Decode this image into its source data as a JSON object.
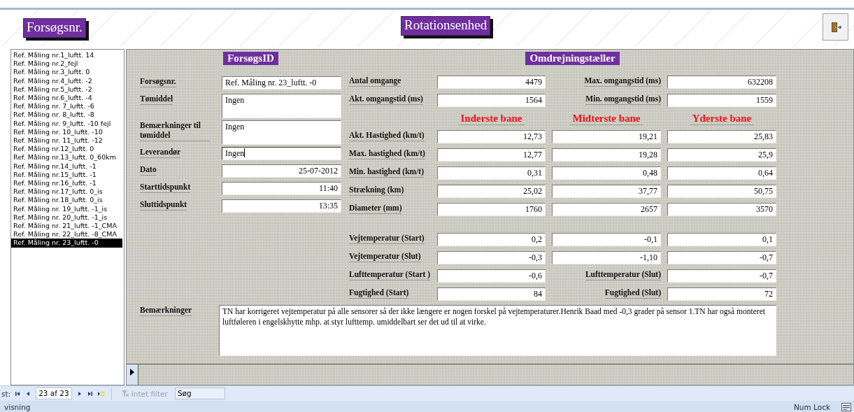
{
  "header": {
    "record_button": "Forsøgsnr.",
    "title": "Rotationsenhed"
  },
  "record_list": [
    {
      "label": "Ref. Måling nr.1_luftt. 14",
      "selected": false
    },
    {
      "label": "Ref. Måling nr.2_fejl",
      "selected": false
    },
    {
      "label": "Ref. Måling nr.3_luftt. 0",
      "selected": false
    },
    {
      "label": "Ref. Måling nr.4_luftt. -2",
      "selected": false
    },
    {
      "label": "Ref. Måling nr.5_luftt. -2",
      "selected": false
    },
    {
      "label": "Ref. Måling nr.6_luftt. -4",
      "selected": false
    },
    {
      "label": "Ref. Måling nr. 7_luftt. -6",
      "selected": false
    },
    {
      "label": "Ref. Måling nr. 8_luftt. -8",
      "selected": false
    },
    {
      "label": "Ref. Måling nr. 9_luftt. -10 fejl",
      "selected": false
    },
    {
      "label": "Ref. Måling nr.  10_luftt. -10",
      "selected": false
    },
    {
      "label": "Ref. Måling nr.  11_luftt. -12",
      "selected": false
    },
    {
      "label": "Ref. Måling nr.12_luftt. 0",
      "selected": false
    },
    {
      "label": "Ref. Måling nr.13_luftt. 0_60km",
      "selected": false
    },
    {
      "label": "Ref. Måling nr.14_luftt. -1",
      "selected": false
    },
    {
      "label": "Ref. Måling nr.15_luftt. -1",
      "selected": false
    },
    {
      "label": "Ref. Måling nr.16_luftt. -1",
      "selected": false
    },
    {
      "label": "Ref. Måling nr.17_luftt. 0_is",
      "selected": false
    },
    {
      "label": "Ref. Måling nr.18_luftt. 0_is",
      "selected": false
    },
    {
      "label": "Ref. Måling nr. 19_luftt. -1_is",
      "selected": false
    },
    {
      "label": "Ref. Måling nr. 20_luftt. -1_is",
      "selected": false
    },
    {
      "label": "Ref. Måling nr. 21_luftt. -1_CMA",
      "selected": false
    },
    {
      "label": "Ref. Måling nr. 22_luftt. -8_CMA",
      "selected": false
    },
    {
      "label": "Ref. Måling nr. 23_luftt. -0",
      "selected": true
    }
  ],
  "section_titles": [
    "ForsøgsID",
    "Omdrejningstæller"
  ],
  "id_fields": [
    {
      "label": "Forsøgsnr.",
      "value": "Ref. Måling nr. 23_luftt. -0",
      "kind": "text",
      "focused": false
    },
    {
      "label": "Tømiddel",
      "value": "Ingen",
      "kind": "memo",
      "focused": false
    },
    {
      "label": "Bemærkninger til tømiddel",
      "value": "Ingen",
      "kind": "memo",
      "focused": false
    },
    {
      "label": "Leverandør",
      "value": "Ingen",
      "kind": "text",
      "focused": true
    },
    {
      "label": "Dato",
      "value": "25-07-2012",
      "kind": "number",
      "focused": false
    },
    {
      "label": "Starttidspunkt",
      "value": "11:40",
      "kind": "number",
      "focused": false
    },
    {
      "label": "Sluttidspunkt",
      "value": "13:35",
      "kind": "number",
      "focused": false
    }
  ],
  "lap_rows": [
    {
      "label": "Antal omgange",
      "value": "4479",
      "label_2": "Max. omgangstid (ms)",
      "value_2": "632208"
    },
    {
      "label": "Akt. omgangstid (ms)",
      "value": "1564",
      "label_2": "Min. omgangstid (ms)",
      "value_2": "1559"
    }
  ],
  "lanes": [
    "Inderste bane",
    "Midterste bane",
    "Yderste bane"
  ],
  "lane_groups": [
    [
      {
        "label": "Akt. Hastighed (km/t)",
        "values": [
          "12,73",
          "19,21",
          "25,83"
        ]
      },
      {
        "label": "Max. hastighed (km/t)",
        "values": [
          "12,77",
          "19,28",
          "25,9"
        ]
      },
      {
        "label": "Min. hastighed (km/t)",
        "values": [
          "0,31",
          "0,48",
          "0,64"
        ]
      },
      {
        "label": "Strækning (km)",
        "values": [
          "25,02",
          "37,77",
          "50,75"
        ]
      },
      {
        "label": "Diameter (mm)",
        "values": [
          "1760",
          "2657",
          "3570"
        ]
      }
    ],
    [
      {
        "label": "Vejtemperatur (Start)",
        "values": [
          "0,2",
          "-0,1",
          "0,1"
        ]
      },
      {
        "label": "Vejtemperatur (Slut)",
        "values": [
          "-0,3",
          "-1,10",
          "-0,7"
        ]
      }
    ]
  ],
  "air_rows": [
    {
      "label": "Lufttemperatur (Start )",
      "value": "-0,6",
      "label_2": "Lufttemperatur (Slut)",
      "value_2": "-0,7"
    },
    {
      "label": "Fugtighed (Start)",
      "value": "84",
      "label_2": "Fugtighed (Slut)",
      "value_2": "72"
    }
  ],
  "remarks": {
    "label": "Bemærkninger",
    "value": "TN har korrigeret vejtemperatur på alle sensorer så der ikke længere er nogen forskel på vejtemperaturer.Henrik Baad med -0,3 grader på sensor 1.TN har også monteret luftføleren i engelskhytte mhp. at styr lufttemp. umiddelbart ser det ud til at virke."
  },
  "record_nav": {
    "prefix": "st:",
    "position": "23 af 23",
    "filter": "Intet filter",
    "filter_disabled": true,
    "search": "Søg"
  },
  "status_bar": {
    "left": "visning",
    "right": "Num Lock"
  }
}
